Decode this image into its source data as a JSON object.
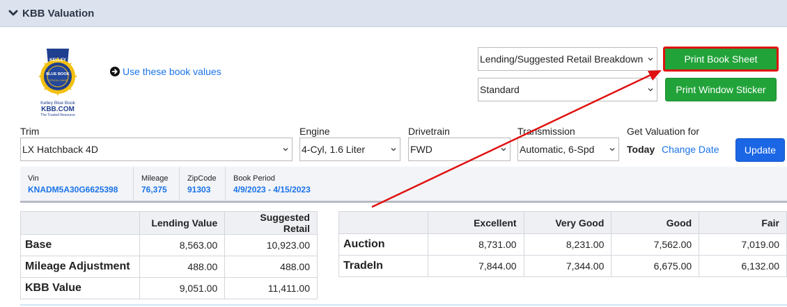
{
  "header": {
    "title": "KBB Valuation"
  },
  "logo": {
    "line1": "Kelley Blue Book",
    "line2": "KBB.COM",
    "line3": "The Trusted Resource",
    "badge_top": "KELLEY",
    "badge_mid": "BLUE BOOK",
    "badge_bottom": "OFFICIAL GUIDE"
  },
  "use_link": {
    "label": "Use these book values"
  },
  "report_select": {
    "value": "Lending/Suggested Retail Breakdown"
  },
  "sticker_select": {
    "value": "Standard"
  },
  "buttons": {
    "print_book_sheet": "Print Book Sheet",
    "print_window_sticker": "Print Window Sticker",
    "update": "Update"
  },
  "fields": {
    "trim": {
      "label": "Trim",
      "value": "LX Hatchback 4D"
    },
    "engine": {
      "label": "Engine",
      "value": "4-Cyl, 1.6 Liter"
    },
    "drivetrain": {
      "label": "Drivetrain",
      "value": "FWD"
    },
    "transmission": {
      "label": "Transmission",
      "value": "Automatic, 6-Spd"
    },
    "valuation": {
      "label": "Get Valuation for",
      "today": "Today",
      "change_date": "Change Date"
    }
  },
  "info": {
    "vin": {
      "label": "Vin",
      "value": "KNADM5A30G6625398"
    },
    "mileage": {
      "label": "Mileage",
      "value": "76,375"
    },
    "zipcode": {
      "label": "ZipCode",
      "value": "91303"
    },
    "book_period": {
      "label": "Book Period",
      "value": "4/9/2023 - 4/15/2023"
    }
  },
  "lending_table": {
    "headers": [
      "",
      "Lending Value",
      "Suggested Retail"
    ],
    "rows": [
      {
        "label": "Base",
        "lending": "8,563.00",
        "retail": "10,923.00"
      },
      {
        "label": "Mileage Adjustment",
        "lending": "488.00",
        "retail": "488.00"
      },
      {
        "label": "KBB Value",
        "lending": "9,051.00",
        "retail": "11,411.00"
      }
    ]
  },
  "condition_table": {
    "headers": [
      "",
      "Excellent",
      "Very Good",
      "Good",
      "Fair"
    ],
    "rows": [
      {
        "label": "Auction",
        "excellent": "8,731.00",
        "very_good": "8,231.00",
        "good": "7,562.00",
        "fair": "7,019.00"
      },
      {
        "label": "TradeIn",
        "excellent": "7,844.00",
        "very_good": "7,344.00",
        "good": "6,675.00",
        "fair": "6,132.00"
      }
    ]
  },
  "colors": {
    "header_bg": "#dde3ee",
    "link": "#1a73e8",
    "green_button": "#22a33a",
    "blue_button": "#1a66e5",
    "annotation": "#e01010"
  }
}
